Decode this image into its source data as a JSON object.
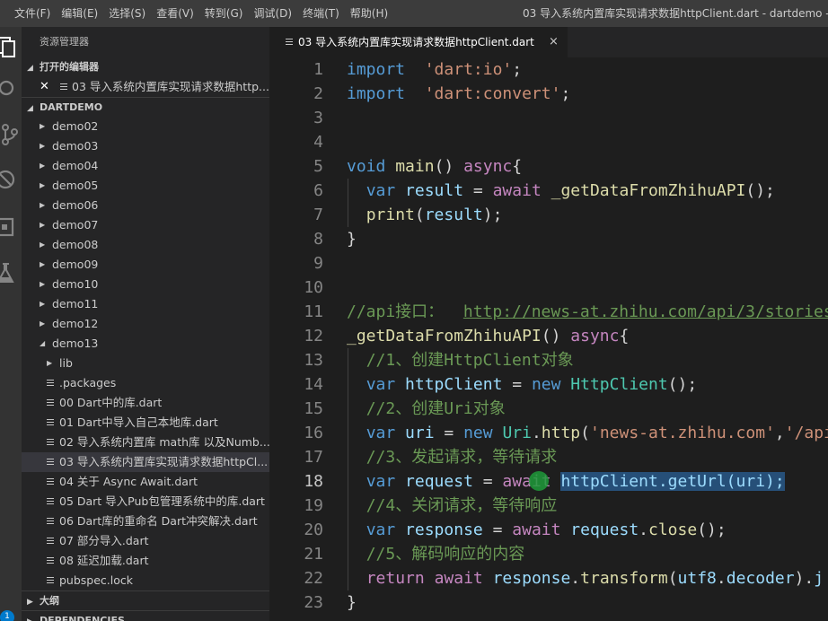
{
  "menu": [
    "文件(F)",
    "编辑(E)",
    "选择(S)",
    "查看(V)",
    "转到(G)",
    "调试(D)",
    "终端(T)",
    "帮助(H)"
  ],
  "window_title": "03 导入系统内置库实现请求数据httpClient.dart - dartdemo - Visi",
  "activity_badge": "1",
  "sidebar": {
    "title": "资源管理器",
    "open_editors_label": "打开的编辑器",
    "open_editor_file": "03 导入系统内置库实现请求数据http...",
    "project_label": "DARTDEMO",
    "folders": [
      "demo02",
      "demo03",
      "demo04",
      "demo05",
      "demo06",
      "demo07",
      "demo08",
      "demo09",
      "demo10",
      "demo11",
      "demo12"
    ],
    "open_folder": "demo13",
    "sub_folder": "lib",
    "files": [
      ".packages",
      "00 Dart中的库.dart",
      "01 Dart中导入自己本地库.dart",
      "02 导入系统内置库 math库 以及Numb...",
      "03 导入系统内置库实现请求数据httpCl...",
      "04 关于 Async Await.dart",
      "05 Dart 导入Pub包管理系统中的库.dart",
      "06 Dart库的重命名 Dart冲突解决.dart",
      "07 部分导入.dart",
      "08 延迟加载.dart",
      "pubspec.lock"
    ],
    "outline_label": "大纲",
    "dependencies_label": "DEPENDENCIES"
  },
  "tab": {
    "label": "03 导入系统内置库实现请求数据httpClient.dart",
    "close_glyph": "×"
  },
  "code_lines": [
    {
      "n": "1",
      "parts": [
        [
          "kw",
          "import"
        ],
        [
          "",
          "  "
        ],
        [
          "str",
          "'dart:io'"
        ],
        [
          "",
          ";"
        ]
      ]
    },
    {
      "n": "2",
      "parts": [
        [
          "kw",
          "import"
        ],
        [
          "",
          "  "
        ],
        [
          "str",
          "'dart:convert'"
        ],
        [
          "",
          ";"
        ]
      ]
    },
    {
      "n": "3",
      "parts": []
    },
    {
      "n": "4",
      "parts": []
    },
    {
      "n": "5",
      "parts": [
        [
          "kw",
          "void"
        ],
        [
          "",
          " "
        ],
        [
          "fn",
          "main"
        ],
        [
          "",
          "() "
        ],
        [
          "kw2",
          "async"
        ],
        [
          "",
          "{"
        ]
      ]
    },
    {
      "n": "6",
      "parts": [
        [
          "",
          "  "
        ],
        [
          "kw",
          "var"
        ],
        [
          "",
          " "
        ],
        [
          "id",
          "result"
        ],
        [
          "",
          " = "
        ],
        [
          "kw2",
          "await"
        ],
        [
          "",
          " "
        ],
        [
          "fn",
          "_getDataFromZhihuAPI"
        ],
        [
          "",
          "();"
        ]
      ]
    },
    {
      "n": "7",
      "parts": [
        [
          "",
          "  "
        ],
        [
          "fn",
          "print"
        ],
        [
          "",
          "("
        ],
        [
          "id",
          "result"
        ],
        [
          "",
          ");"
        ]
      ]
    },
    {
      "n": "8",
      "parts": [
        [
          "",
          "}"
        ]
      ]
    },
    {
      "n": "9",
      "parts": []
    },
    {
      "n": "10",
      "parts": []
    },
    {
      "n": "11",
      "parts": [
        [
          "cm",
          "//api接口：  "
        ],
        [
          "lnk",
          "http://news-at.zhihu.com/api/3/stories"
        ]
      ]
    },
    {
      "n": "12",
      "parts": [
        [
          "fn",
          "_getDataFromZhihuAPI"
        ],
        [
          "",
          "() "
        ],
        [
          "kw2",
          "async"
        ],
        [
          "",
          "{"
        ]
      ]
    },
    {
      "n": "13",
      "parts": [
        [
          "",
          "  "
        ],
        [
          "cm",
          "//1、创建HttpClient对象"
        ]
      ]
    },
    {
      "n": "14",
      "parts": [
        [
          "",
          "  "
        ],
        [
          "kw",
          "var"
        ],
        [
          "",
          " "
        ],
        [
          "id",
          "httpClient"
        ],
        [
          "",
          " = "
        ],
        [
          "kw",
          "new"
        ],
        [
          "",
          " "
        ],
        [
          "cls",
          "HttpClient"
        ],
        [
          "",
          "();"
        ]
      ]
    },
    {
      "n": "15",
      "parts": [
        [
          "",
          "  "
        ],
        [
          "cm",
          "//2、创建Uri对象"
        ]
      ]
    },
    {
      "n": "16",
      "parts": [
        [
          "",
          "  "
        ],
        [
          "kw",
          "var"
        ],
        [
          "",
          " "
        ],
        [
          "id",
          "uri"
        ],
        [
          "",
          " = "
        ],
        [
          "kw",
          "new"
        ],
        [
          "",
          " "
        ],
        [
          "cls",
          "Uri"
        ],
        [
          "",
          "."
        ],
        [
          "fn",
          "http"
        ],
        [
          "",
          "("
        ],
        [
          "str",
          "'news-at.zhihu.com'"
        ],
        [
          "",
          ","
        ],
        [
          "str",
          "'/api"
        ]
      ]
    },
    {
      "n": "17",
      "parts": [
        [
          "",
          "  "
        ],
        [
          "cm",
          "//3、发起请求，等待请求"
        ]
      ]
    },
    {
      "n": "18",
      "parts": [
        [
          "",
          "  "
        ],
        [
          "kw",
          "var"
        ],
        [
          "",
          " "
        ],
        [
          "id",
          "request"
        ],
        [
          "",
          " = "
        ],
        [
          "kw2",
          "await"
        ],
        [
          "",
          " "
        ],
        [
          "sel",
          "httpClient.getUrl(uri);"
        ]
      ]
    },
    {
      "n": "19",
      "parts": [
        [
          "",
          "  "
        ],
        [
          "cm",
          "//4、关闭请求，等待响应"
        ]
      ]
    },
    {
      "n": "20",
      "parts": [
        [
          "",
          "  "
        ],
        [
          "kw",
          "var"
        ],
        [
          "",
          " "
        ],
        [
          "id",
          "response"
        ],
        [
          "",
          " = "
        ],
        [
          "kw2",
          "await"
        ],
        [
          "",
          " "
        ],
        [
          "id",
          "request"
        ],
        [
          "",
          "."
        ],
        [
          "fn",
          "close"
        ],
        [
          "",
          "();"
        ]
      ]
    },
    {
      "n": "21",
      "parts": [
        [
          "",
          "  "
        ],
        [
          "cm",
          "//5、解码响应的内容"
        ]
      ]
    },
    {
      "n": "22",
      "parts": [
        [
          "",
          "  "
        ],
        [
          "kw2",
          "return"
        ],
        [
          "",
          " "
        ],
        [
          "kw2",
          "await"
        ],
        [
          "",
          " "
        ],
        [
          "id",
          "response"
        ],
        [
          "",
          "."
        ],
        [
          "fn",
          "transform"
        ],
        [
          "",
          "("
        ],
        [
          "id",
          "utf8"
        ],
        [
          "",
          "."
        ],
        [
          "id",
          "decoder"
        ],
        [
          "",
          ")."
        ],
        [
          "id",
          "j"
        ]
      ]
    },
    {
      "n": "23",
      "parts": [
        [
          "",
          "}"
        ]
      ]
    }
  ],
  "current_line": "18"
}
